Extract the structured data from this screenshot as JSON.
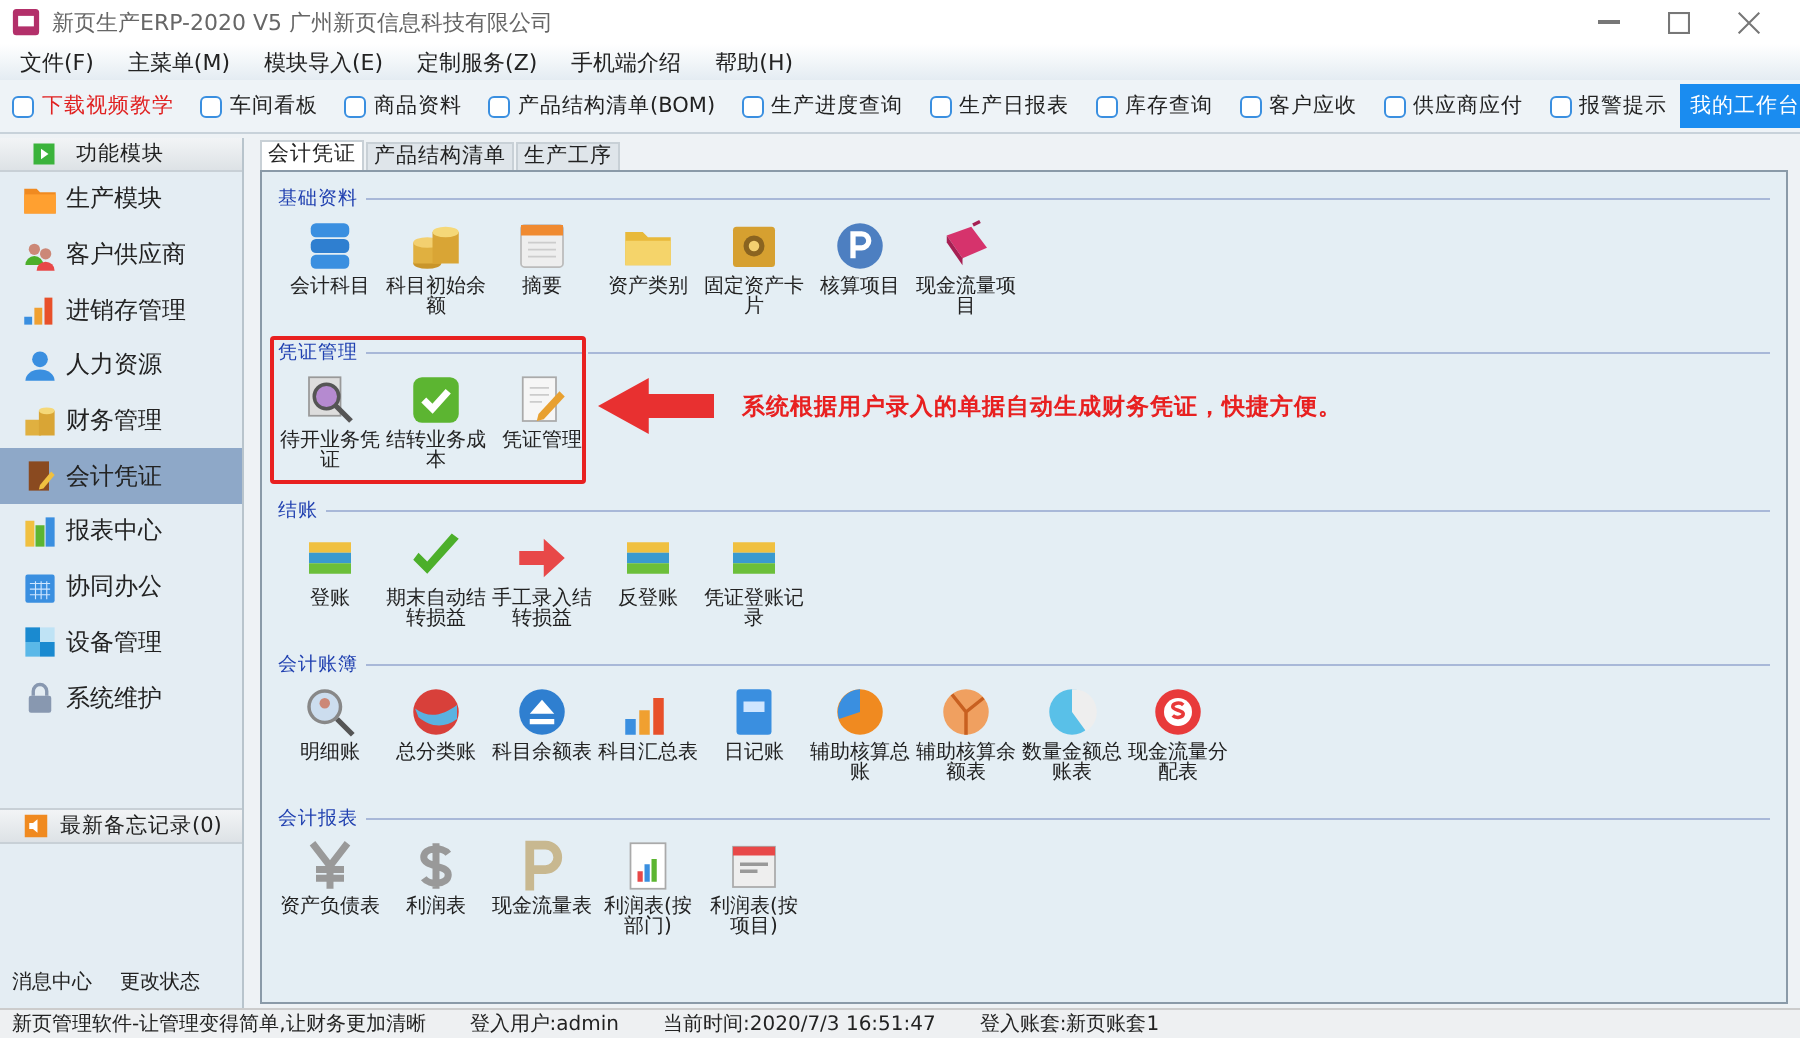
{
  "window": {
    "title": "新页生产ERP-2020 V5 广州新页信息科技有限公司"
  },
  "menu": [
    "文件(F)",
    "主菜单(M)",
    "模块导入(E)",
    "定制服务(Z)",
    "手机端介绍",
    "帮助(H)"
  ],
  "toolbar": {
    "items": [
      {
        "label": "下载视频教学",
        "checked": false,
        "highlighted": true
      },
      {
        "label": "车间看板",
        "checked": false,
        "highlighted": false
      },
      {
        "label": "商品资料",
        "checked": false,
        "highlighted": false
      },
      {
        "label": "产品结构清单(BOM)",
        "checked": false,
        "highlighted": false
      },
      {
        "label": "生产进度查询",
        "checked": false,
        "highlighted": false
      },
      {
        "label": "生产日报表",
        "checked": false,
        "highlighted": false
      },
      {
        "label": "库存查询",
        "checked": false,
        "highlighted": false
      },
      {
        "label": "客户应收",
        "checked": false,
        "highlighted": false
      },
      {
        "label": "供应商应付",
        "checked": false,
        "highlighted": false
      },
      {
        "label": "报警提示",
        "checked": false,
        "highlighted": false
      }
    ],
    "workbench_button": "我的工作台"
  },
  "sidebar": {
    "header": "功能模块",
    "items": [
      {
        "label": "生产模块",
        "selected": false
      },
      {
        "label": "客户供应商",
        "selected": false
      },
      {
        "label": "进销存管理",
        "selected": false
      },
      {
        "label": "人力资源",
        "selected": false
      },
      {
        "label": "财务管理",
        "selected": false
      },
      {
        "label": "会计凭证",
        "selected": true
      },
      {
        "label": "报表中心",
        "selected": false
      },
      {
        "label": "协同办公",
        "selected": false
      },
      {
        "label": "设备管理",
        "selected": false
      },
      {
        "label": "系统维护",
        "selected": false
      }
    ],
    "memo_header": "最新备忘记录(0)",
    "footer_links": [
      "消息中心",
      "更改状态"
    ]
  },
  "tabs": [
    {
      "label": "会计凭证",
      "selected": true
    },
    {
      "label": "产品结构清单",
      "selected": false
    },
    {
      "label": "生产工序",
      "selected": false
    }
  ],
  "sections": [
    {
      "title": "基础资料",
      "outlined": false,
      "items": [
        "会计科目",
        "科目初始余额",
        "摘要",
        "资产类别",
        "固定资产卡片",
        "核算项目",
        "现金流量项目"
      ]
    },
    {
      "title": "凭证管理",
      "outlined": true,
      "items": [
        "待开业务凭证",
        "结转业务成本",
        "凭证管理"
      ]
    },
    {
      "title": "结账",
      "outlined": false,
      "items": [
        "登账",
        "期末自动结转损益",
        "手工录入结转损益",
        "反登账",
        "凭证登账记录"
      ]
    },
    {
      "title": "会计账簿",
      "outlined": false,
      "items": [
        "明细账",
        "总分类账",
        "科目余额表",
        "科目汇总表",
        "日记账",
        "辅助核算总账",
        "辅助核算余额表",
        "数量金额总账表",
        "现金流量分配表"
      ]
    },
    {
      "title": "会计报表",
      "outlined": false,
      "items": [
        "资产负债表",
        "利润表",
        "现金流量表",
        "利润表(按部门)",
        "利润表(按项目)"
      ]
    }
  ],
  "annotation": {
    "text": "系统根据用户录入的单据自动生成财务凭证，快捷方便。"
  },
  "status_bar": [
    "新页管理软件-让管理变得简单,让财务更加清晰",
    "登入用户:admin",
    "当前时间:2020/7/3 16:51:47",
    "登入账套:新页账套1"
  ]
}
